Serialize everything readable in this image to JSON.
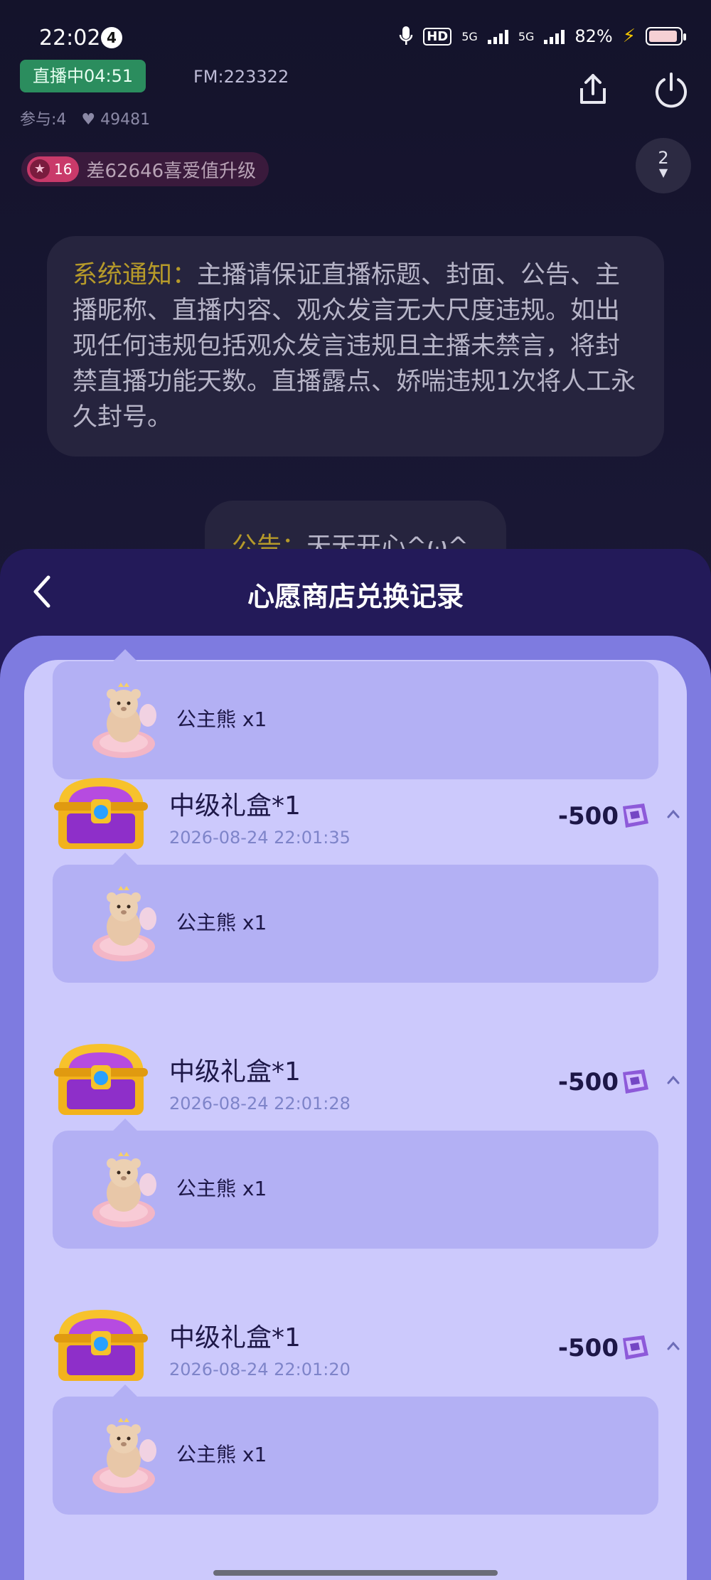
{
  "status_bar": {
    "time": "22:02",
    "notif_count": "4",
    "network1": "5G",
    "network2": "5G",
    "hd": "HD",
    "battery": "82%"
  },
  "live": {
    "status": "直播中04:51",
    "fm": "FM:223322",
    "participants": "参与:4",
    "likes": "49481",
    "level": "16",
    "level_text": "差62646喜爱值升级",
    "viewer_count": "2"
  },
  "notice": {
    "label": "系统通知：",
    "text": "主播请保证直播标题、封面、公告、主播昵称、直播内容、观众发言无大尺度违规。如出现任何违规包括观众发言违规且主播未禁言，将封禁直播功能天数。直播露点、娇喘违规1次将人工永久封号。"
  },
  "announcement": {
    "label": "公告：",
    "text": "天天开心^ω^"
  },
  "sheet": {
    "title": "心愿商店兑换记录",
    "first_detail": "公主熊 x1",
    "records": [
      {
        "name": "中级礼盒*1",
        "date": "2026-08-24 22:01:35",
        "amount": "-500",
        "detail": "公主熊 x1"
      },
      {
        "name": "中级礼盒*1",
        "date": "2026-08-24 22:01:28",
        "amount": "-500",
        "detail": "公主熊 x1"
      },
      {
        "name": "中级礼盒*1",
        "date": "2026-08-24 22:01:20",
        "amount": "-500",
        "detail": "公主熊 x1"
      }
    ]
  },
  "colors": {
    "accent": "#7e7be0",
    "card": "#ccc9fc",
    "detail": "#b3b0f4",
    "live": "#2b8d5e"
  }
}
